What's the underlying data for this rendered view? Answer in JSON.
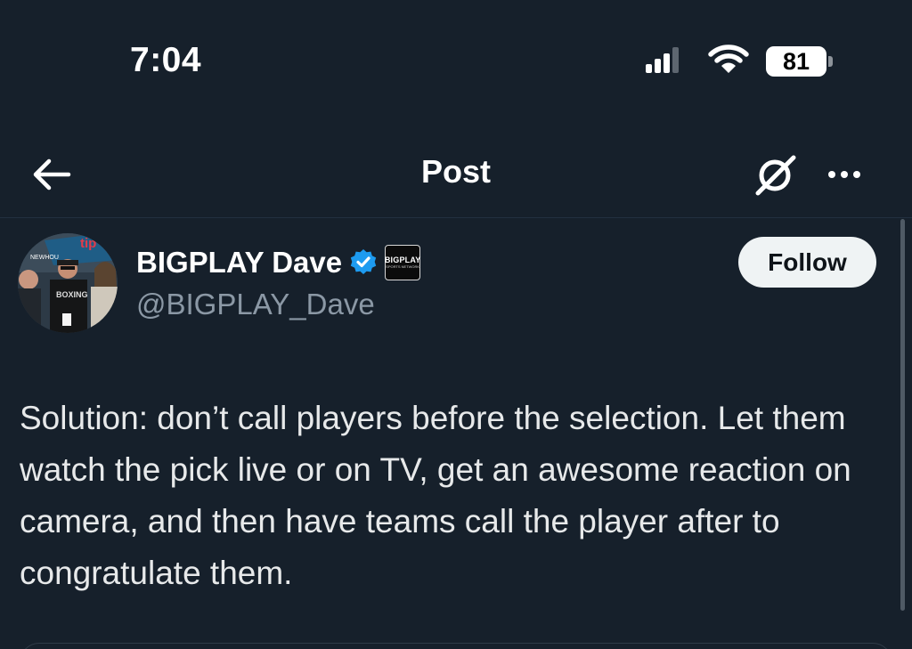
{
  "status_bar": {
    "time": "7:04",
    "battery_level": "81",
    "signal_icon": "cellular-signal-icon",
    "wifi_icon": "wifi-icon"
  },
  "nav": {
    "title": "Post",
    "back_icon": "arrow-left-icon",
    "grok_icon": "grok-icon",
    "more_icon": "more-horizontal-icon"
  },
  "author": {
    "name": "BIGPLAY Dave",
    "handle": "@BIGPLAY_Dave",
    "verified_icon": "verified-badge-icon",
    "affiliate_line1": "BIGPLAY",
    "affiliate_line2": "SPORTS NETWORK"
  },
  "follow_label": "Follow",
  "post": {
    "text": "Solution: don’t call players before the selection. Let them watch the pick live or on TV, get an awesome reaction on camera, and then have teams call the player after to congratulate them."
  },
  "colors": {
    "background": "#16202b",
    "verified": "#1d9bf0",
    "follow_bg": "#eff3f4",
    "handle": "#8b98a5"
  }
}
